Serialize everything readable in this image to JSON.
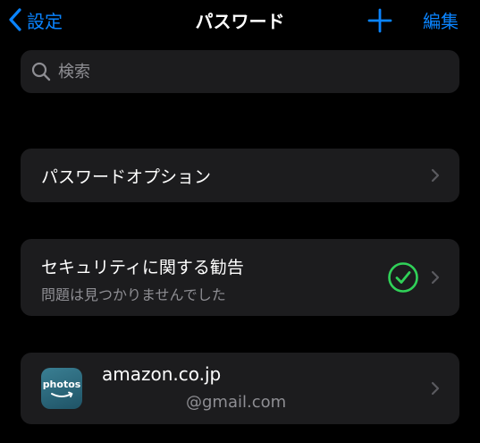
{
  "navbar": {
    "back_label": "設定",
    "title": "パスワード",
    "edit_label": "編集"
  },
  "search": {
    "placeholder": "検索",
    "value": ""
  },
  "options_cell": {
    "title": "パスワードオプション"
  },
  "security_cell": {
    "title": "セキュリティに関する勧告",
    "subtitle": "問題は見つかりませんでした",
    "status": "ok"
  },
  "accounts": [
    {
      "icon_text": "photos",
      "domain": "amazon.co.jp",
      "username": "@gmail.com"
    }
  ],
  "colors": {
    "accent": "#0a84ff",
    "success": "#30d158",
    "cell_background": "#1c1c1e",
    "secondary_text": "#8e8e93"
  },
  "icons": [
    "chevron-left-icon",
    "plus-icon",
    "magnifying-glass-icon",
    "chevron-right-icon",
    "checkmark-circle-icon",
    "amazon-photos-app-icon"
  ]
}
